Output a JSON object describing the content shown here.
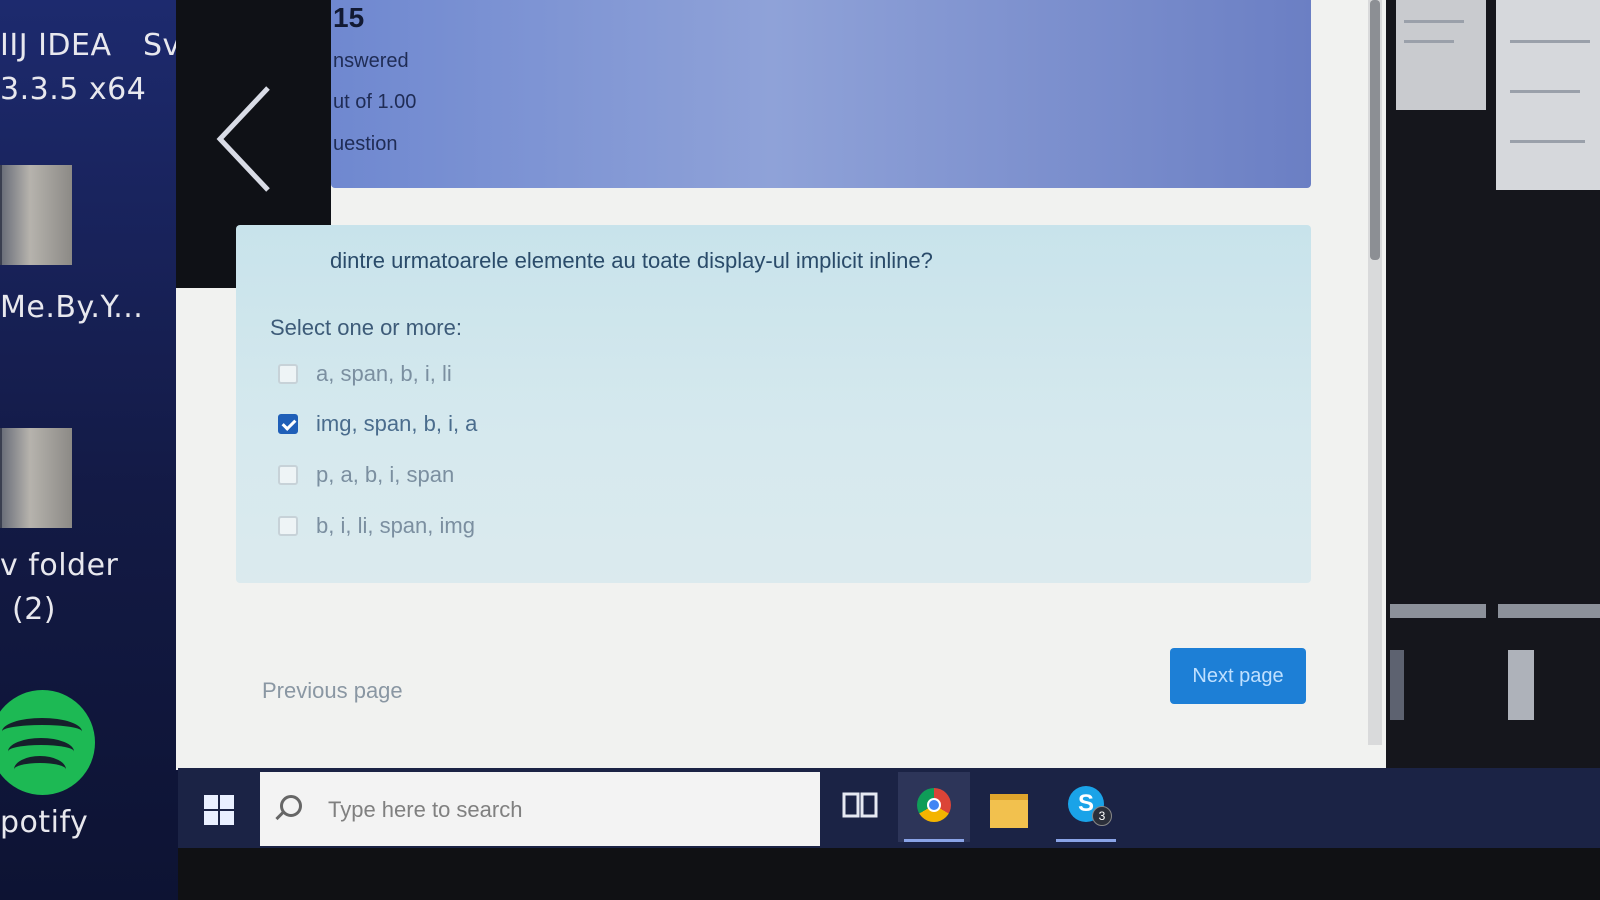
{
  "desktop": {
    "icons": [
      {
        "label_line1": "IIJ IDEA",
        "label_line1b": "Sv",
        "label_line2": "3.3.5 x64"
      },
      {
        "label_line1": "Me.By.Y..."
      },
      {
        "label_line1": "v folder",
        "label_line2": "(2)"
      },
      {
        "label_line1": "potify"
      }
    ]
  },
  "quiz": {
    "info": {
      "number": "15",
      "status": "nswered",
      "mark": "ut of 1.00",
      "flag": "uestion"
    },
    "question": {
      "text": "dintre urmatoarele elemente au toate display-ul implicit inline?",
      "prompt": "Select one or more:",
      "options": [
        {
          "label": "a, span, b, i, li",
          "checked": false
        },
        {
          "label": "img, span, b, i, a",
          "checked": true
        },
        {
          "label": "p, a, b, i, span",
          "checked": false
        },
        {
          "label": "b, i, li, span, img",
          "checked": false
        }
      ]
    },
    "navigation": {
      "previous_label": "Previous page",
      "next_label": "Next page"
    }
  },
  "taskbar": {
    "search_placeholder": "Type here to search",
    "skype_badge": "3",
    "skype_letter": "S",
    "apps": [
      "start-icon",
      "task-view-icon",
      "chrome-icon",
      "file-explorer-icon",
      "skype-icon"
    ]
  },
  "colors": {
    "info_box": "#7f94d3",
    "question_box": "#d1e6ec",
    "next_button": "#1d7fd6",
    "checkbox_checked": "#1f5fb8"
  }
}
